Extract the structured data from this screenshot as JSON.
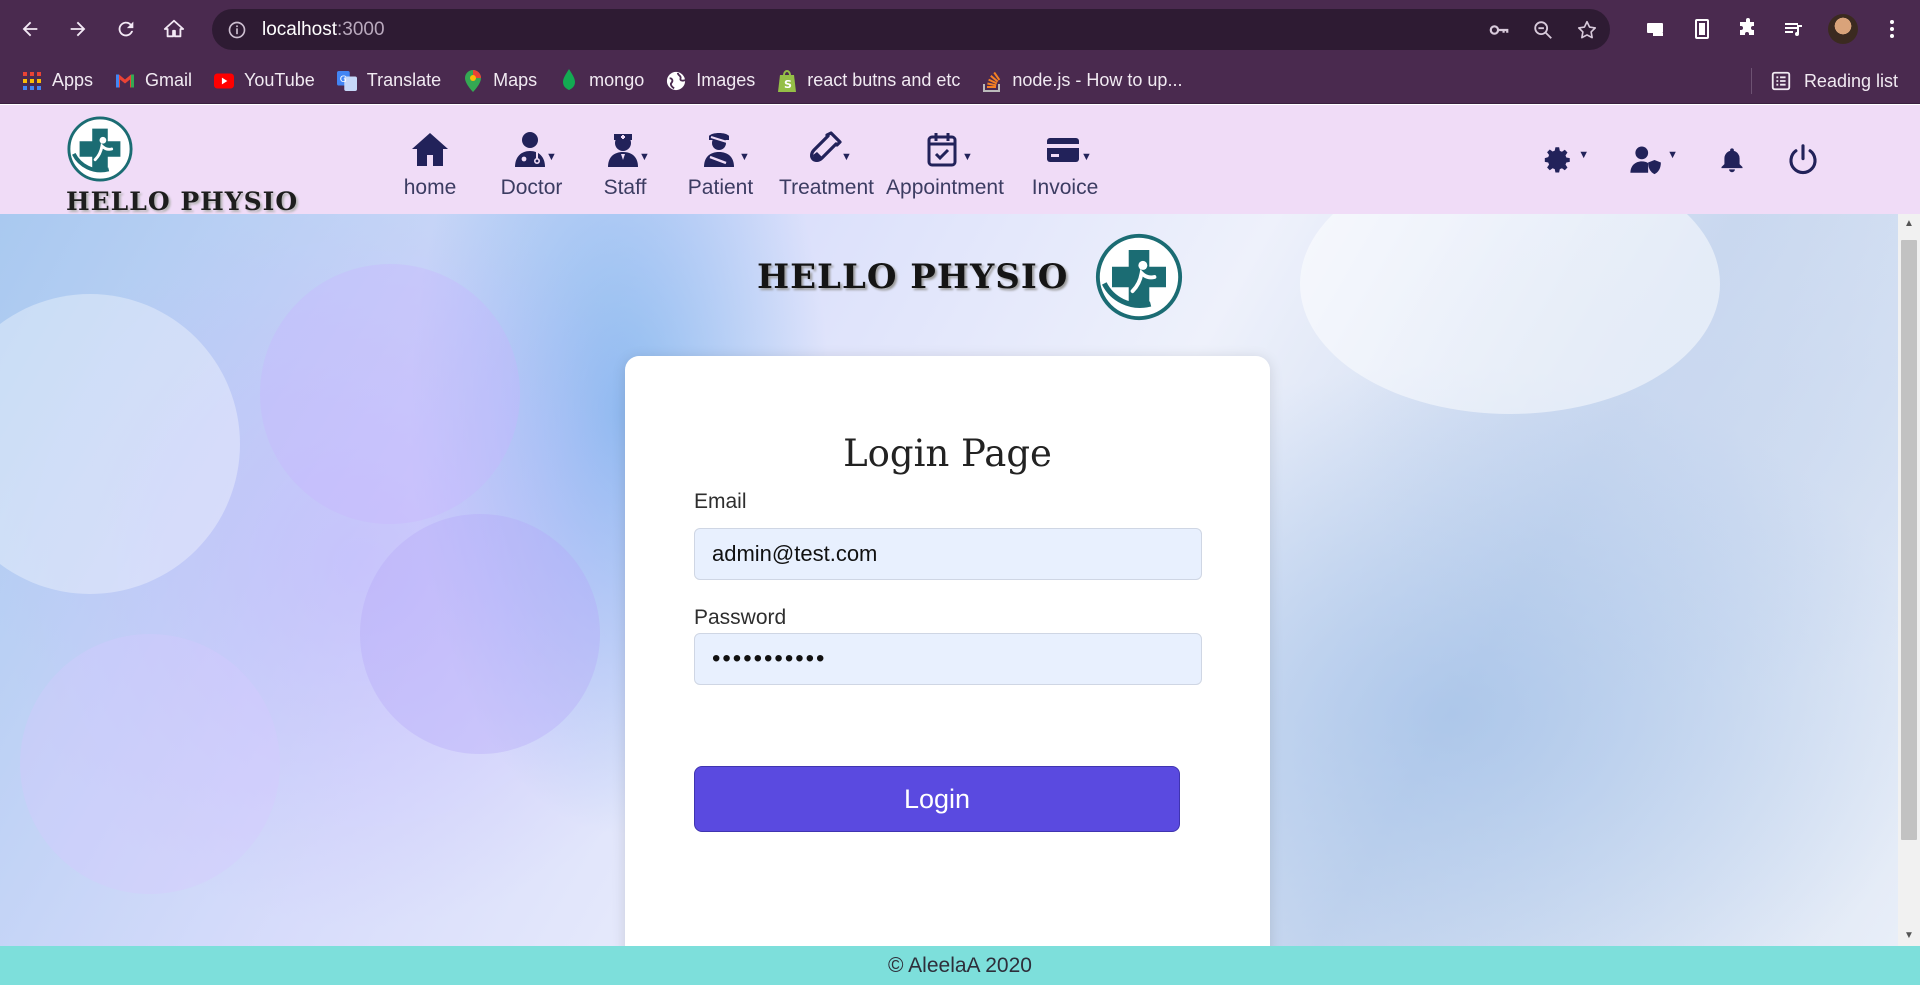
{
  "browser": {
    "url_host": "localhost",
    "url_port": ":3000",
    "bookmarks": [
      {
        "label": "Apps",
        "icon": "apps-grid-icon",
        "color": "#ea4335"
      },
      {
        "label": "Gmail",
        "icon": "gmail-icon",
        "color": "#ea4335"
      },
      {
        "label": "YouTube",
        "icon": "youtube-icon",
        "color": "#ff0000"
      },
      {
        "label": "Translate",
        "icon": "translate-icon",
        "color": "#4285f4"
      },
      {
        "label": "Maps",
        "icon": "maps-icon",
        "color": "#34a853"
      },
      {
        "label": "mongo",
        "icon": "mongo-leaf-icon",
        "color": "#13aa52"
      },
      {
        "label": "Images",
        "icon": "globe-icon",
        "color": "#ffffff"
      },
      {
        "label": "react butns and etc",
        "icon": "shopify-bag-icon",
        "color": "#95bf47"
      },
      {
        "label": "node.js - How to up...",
        "icon": "stackoverflow-icon",
        "color": "#f48024"
      }
    ],
    "reading_list": "Reading list"
  },
  "navbar": {
    "brand": "HELLO PHYSIO",
    "items": [
      {
        "label": "home",
        "icon": "home-icon",
        "has_dropdown": false
      },
      {
        "label": "Doctor",
        "icon": "doctor-icon",
        "has_dropdown": true
      },
      {
        "label": "Staff",
        "icon": "nurse-icon",
        "has_dropdown": true
      },
      {
        "label": "Patient",
        "icon": "patient-injured-icon",
        "has_dropdown": true
      },
      {
        "label": "Treatment",
        "icon": "syringe-vial-icon",
        "has_dropdown": true
      },
      {
        "label": "Appointment",
        "icon": "calendar-check-icon",
        "has_dropdown": true
      },
      {
        "label": "Invoice",
        "icon": "credit-card-icon",
        "has_dropdown": true
      }
    ],
    "right": [
      "gear-icon",
      "user-shield-icon",
      "bell-icon",
      "power-icon"
    ]
  },
  "main": {
    "brand": "HELLO PHYSIO",
    "login": {
      "title": "Login Page",
      "email_label": "Email",
      "email_value": "admin@test.com",
      "password_label": "Password",
      "password_value": "•••••••••••",
      "button": "Login"
    }
  },
  "footer": {
    "text": "© AleelaA 2020"
  },
  "colors": {
    "chrome": "#4a2a4f",
    "navbar": "#f0dcf7",
    "login_button": "#5a4ae0",
    "footer": "#7ddfdb",
    "input_bg": "#e8f0fe"
  }
}
